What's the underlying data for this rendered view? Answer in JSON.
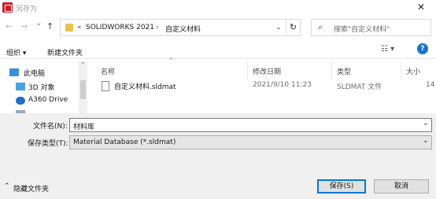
{
  "window": {
    "title": "另存为",
    "close_glyph": "✕",
    "app_icon": "solidworks-app-icon"
  },
  "nav": {
    "back_glyph": "←",
    "forward_glyph": "→",
    "recent_glyph": "⌄",
    "up_glyph": "↑"
  },
  "address": {
    "prefix": "«",
    "crumbs": [
      "SOLIDWORKS 2021",
      "自定义材料"
    ],
    "separator": "›",
    "dropdown_glyph": "⌄",
    "refresh_glyph": "↻"
  },
  "search": {
    "icon_glyph": "⌕",
    "placeholder": "搜索\"自定义材料\""
  },
  "toolbar": {
    "organize_label": "组织 ▾",
    "new_folder_label": "新建文件夹",
    "view_glyph": "☷ ▾",
    "help_glyph": "?"
  },
  "sidebar": {
    "items": [
      {
        "label": "此电脑",
        "icon": "computer-icon"
      },
      {
        "label": "3D 对象",
        "icon": "3d-objects-icon"
      },
      {
        "label": "A360 Drive",
        "icon": "a360-drive-icon"
      }
    ],
    "scroll_up_glyph": "⌃"
  },
  "file_list": {
    "sort_glyph": "^",
    "columns": [
      "名称",
      "修改日期",
      "类型",
      "大小"
    ],
    "rows": [
      {
        "name": "自定义材料.sldmat",
        "date": "2021/9/10 11:23",
        "type": "SLDMAT 文件",
        "size": "14"
      }
    ]
  },
  "form": {
    "filename_label": "文件名(N):",
    "filename_value": "材料库",
    "filetype_label": "保存类型(T):",
    "filetype_value": "Material Database (*.sldmat)",
    "chevron_glyph": "⌄"
  },
  "footer": {
    "hide_folders_label": "隐藏文件夹",
    "hide_glyph": "⌃",
    "save_label": "保存(S)",
    "cancel_label": "取消"
  },
  "colors": {
    "accent": "#0078d7",
    "folder": "#e8c24a"
  }
}
